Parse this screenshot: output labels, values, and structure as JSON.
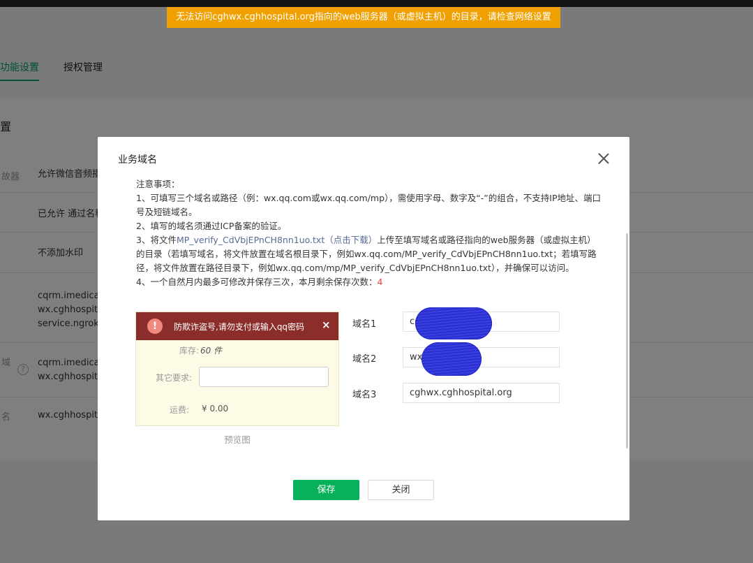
{
  "bookmarks": [
    "...",
    "",
    "",
    "",
    "",
    "",
    "",
    ""
  ],
  "banner": {
    "text": "无法访问cghwx.cghhospital.org指向的web服务器（或虚拟主机）的目录，请检查网络设置"
  },
  "background": {
    "tabs": [
      {
        "label": "功能设置"
      },
      {
        "label": "授权管理"
      }
    ],
    "section_title": "置",
    "rows": [
      {
        "label": "故器",
        "value": "允许微信音频播"
      },
      {
        "label": "",
        "value": "已允许 通过名称"
      },
      {
        "label": "",
        "value": "不添加水印"
      },
      {
        "label": "",
        "value": "cqrm.imedicala\nwx.cghhospita\nservice.ngrok.l"
      },
      {
        "label": "域",
        "value": "cqrm.imedicala\nwx.cghhospita"
      },
      {
        "label": "名",
        "value": "wx.cghhospita"
      }
    ],
    "help_icon": "?"
  },
  "dialog": {
    "title": "业务域名",
    "notes": {
      "heading": "注意事项：",
      "item1": "1、可填写三个域名或路径（例：wx.qq.com或wx.qq.com/mp），需使用字母、数字及“-”的组合，不支持IP地址、端口号及短链域名。",
      "item2": "2、填写的域名须通过ICP备案的验证。",
      "item3_prefix": "3、将文件",
      "item3_link": "MP_verify_CdVbjEPnCH8nn1uo.txt（点击下载）",
      "item3_suffix": "上传至填写域名或路径指向的web服务器（或虚拟主机）的目录（若填写域名，将文件放置在域名根目录下，例如wx.qq.com/MP_verify_CdVbjEPnCH8nn1uo.txt；若填写路径，将文件放置在路径目录下，例如wx.qq.com/mp/MP_verify_CdVbjEPnCH8nn1uo.txt），并确保可以访问。",
      "item4_prefix": "4、一个自然月内最多可修改并保存三次，本月剩余保存次数：",
      "item4_count": "4"
    },
    "preview": {
      "alert_text": "防欺诈盗号,请勿支付或输入qq密码",
      "alert_close": "×",
      "stock_label": "库存:",
      "stock_value": "60 件",
      "other_label": "其它要求:",
      "shipping_label": "运费:",
      "shipping_value": "¥ 0.00",
      "caption": "预览图"
    },
    "domains": [
      {
        "label": "域名1",
        "value": "cq                              n"
      },
      {
        "label": "域名2",
        "value": "wx                           rg"
      },
      {
        "label": "域名3",
        "value": "cghwx.cghhospital.org"
      }
    ],
    "buttons": {
      "save": "保存",
      "close": "关闭"
    }
  },
  "colors": {
    "accent_green": "#07b05a",
    "banner_orange": "#f0a000",
    "link_blue": "#576b95",
    "count_red": "#e64340",
    "alert_red": "#8b2e2b"
  }
}
